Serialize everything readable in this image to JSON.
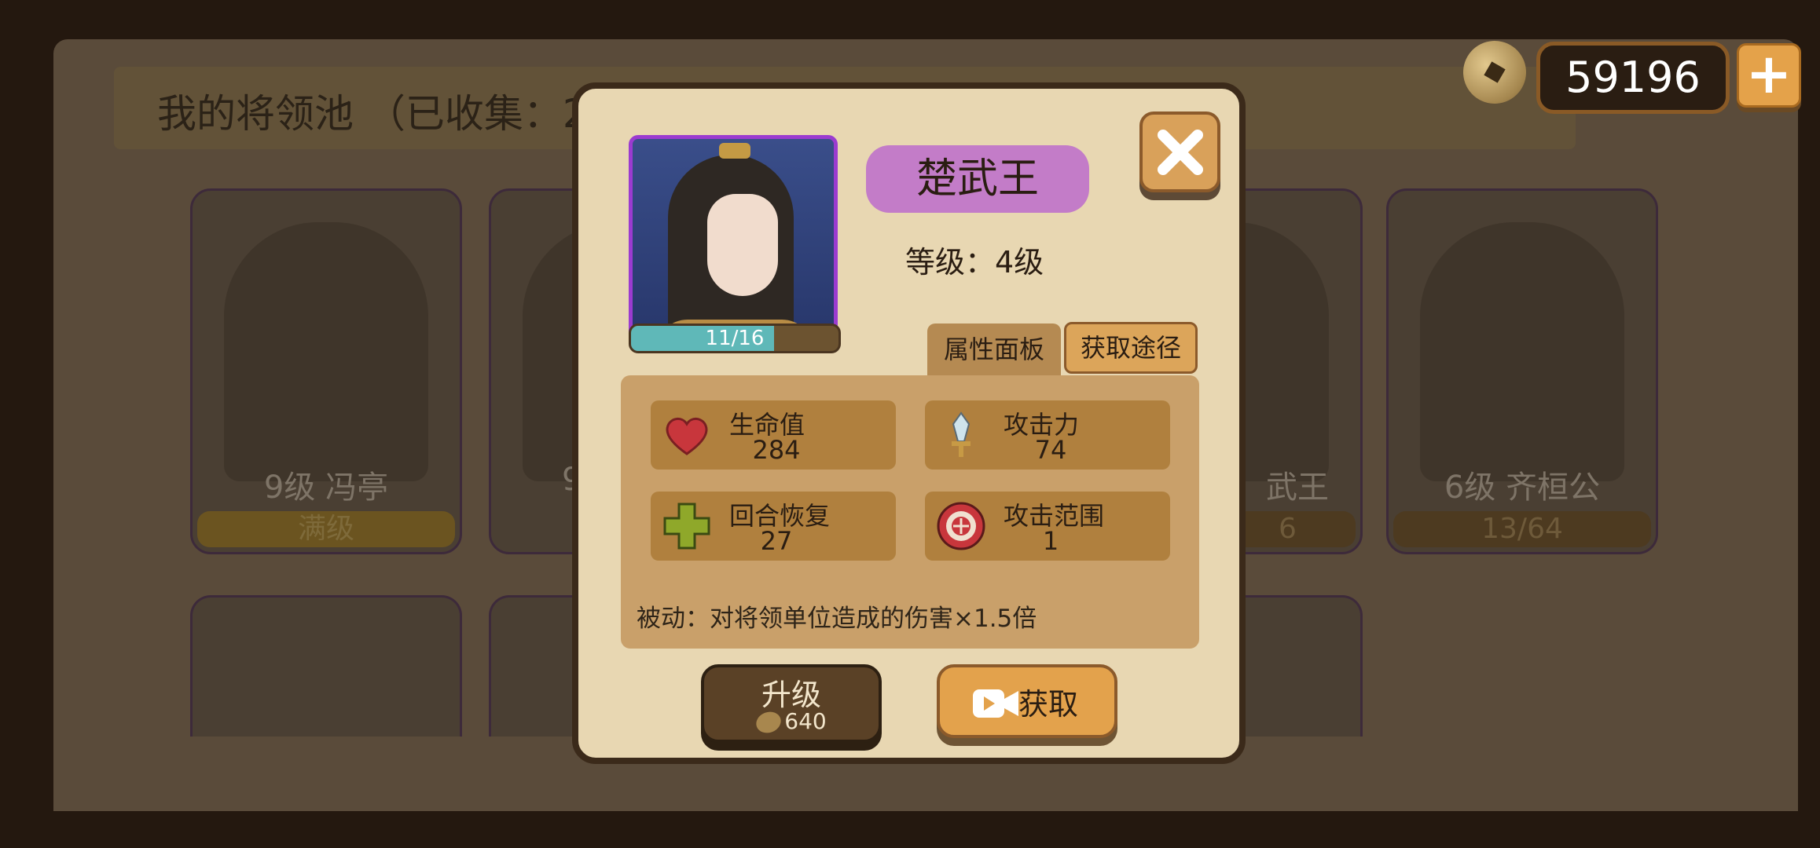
{
  "background": {
    "title": "我的将领池 （已收集：2",
    "cards": [
      {
        "name": "9级  冯亭",
        "bar": "满级"
      },
      {
        "name": "9",
        "bar": ""
      },
      {
        "name": "武王",
        "bar": "6"
      },
      {
        "name": "6级 齐桓公",
        "bar": "13/64"
      }
    ]
  },
  "currency": {
    "coin_icon": "copper-coin-icon",
    "amount": "59196",
    "add_icon": "plus-icon"
  },
  "dialog": {
    "general_name": "楚武王",
    "level": "等级：4级",
    "progress": {
      "text": "11/16",
      "current": 11,
      "max": 16
    },
    "tabs": {
      "attributes": "属性面板",
      "acquire": "获取途径"
    },
    "stats": [
      {
        "icon": "heart-icon",
        "label": "生命值",
        "value": "284"
      },
      {
        "icon": "sword-icon",
        "label": "攻击力",
        "value": "74"
      },
      {
        "icon": "plus-cross-icon",
        "label": "回合恢复",
        "value": "27"
      },
      {
        "icon": "target-icon",
        "label": "攻击范围",
        "value": "1"
      }
    ],
    "passive": "被动：对将领单位造成的伤害×1.5倍",
    "upgrade": {
      "label": "升级",
      "cost": "640"
    },
    "acquire": {
      "label": "获取",
      "icon": "video-icon"
    },
    "close_icon": "close-icon"
  },
  "colors": {
    "portrait_border": "#9b3bd0",
    "name_pill": "#c37cc8",
    "button_orange": "#e3a24c",
    "progress_fill": "#5fb8b8"
  }
}
